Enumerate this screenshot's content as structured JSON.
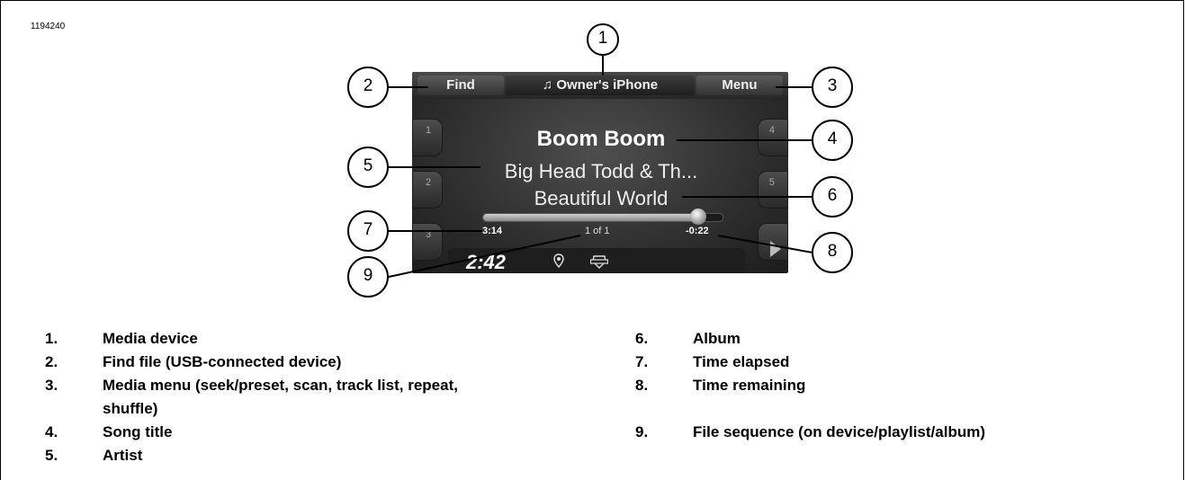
{
  "figure_id": "1194240",
  "screen": {
    "find_label": "Find",
    "device_label": "♫ Owner's iPhone",
    "menu_label": "Menu",
    "presets_left": [
      "1",
      "2",
      "3"
    ],
    "presets_right": [
      "4",
      "5",
      ""
    ],
    "song_title": "Boom Boom",
    "artist": "Big Head Todd & Th...",
    "album": "Beautiful World",
    "elapsed": "3:14",
    "sequence": "1 of 1",
    "remaining": "-0:22",
    "progress_fraction": 0.9,
    "clock": "2:42",
    "icons": [
      "gps-icon",
      "bar-and-shield-logo-icon",
      "play-icon"
    ]
  },
  "callouts": [
    "1",
    "2",
    "3",
    "4",
    "5",
    "6",
    "7",
    "8",
    "9"
  ],
  "legend": [
    {
      "num": "1.",
      "text": "Media device"
    },
    {
      "num": "2.",
      "text": "Find file (USB-connected device)"
    },
    {
      "num": "3.",
      "text": "Media menu (seek/preset, scan, track list, repeat,"
    },
    {
      "num": "",
      "text": "shuffle)"
    },
    {
      "num": "4.",
      "text": "Song title"
    },
    {
      "num": "5.",
      "text": "Artist"
    },
    {
      "num": "6.",
      "text": "Album"
    },
    {
      "num": "7.",
      "text": "Time elapsed"
    },
    {
      "num": "8.",
      "text": "Time remaining"
    },
    {
      "num": "9.",
      "text": "File sequence (on device/playlist/album)"
    }
  ]
}
